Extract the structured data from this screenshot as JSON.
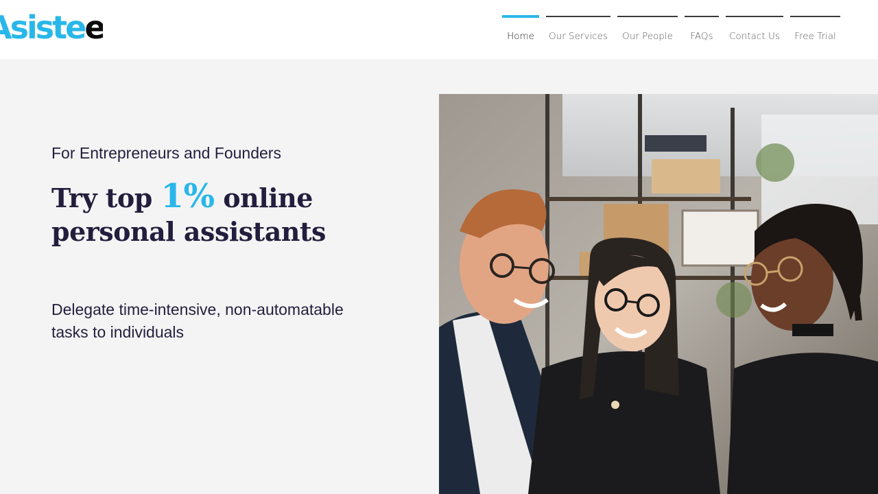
{
  "header": {
    "logo": {
      "part1": "Asiste",
      "part2": "e"
    },
    "nav": [
      {
        "label": "Home",
        "active": true
      },
      {
        "label": "Our Services",
        "active": false
      },
      {
        "label": "Our People",
        "active": false
      },
      {
        "label": "FAQs",
        "active": false
      },
      {
        "label": "Contact Us",
        "active": false
      },
      {
        "label": "Free Trial",
        "active": false
      }
    ]
  },
  "hero": {
    "eyebrow": "For Entrepreneurs and Founders",
    "headline_part1": "Try top ",
    "headline_accent": "1%",
    "headline_part2": " online personal assistants",
    "subtext": "Delegate time-intensive, non-automatable tasks to individuals"
  },
  "colors": {
    "accent": "#29b7ea",
    "text_dark": "#231e3d",
    "header_bg": "#ffffff",
    "page_bg": "#f4f4f4"
  },
  "icons": {
    "hero_image": "three-smiling-colleagues-photo"
  }
}
